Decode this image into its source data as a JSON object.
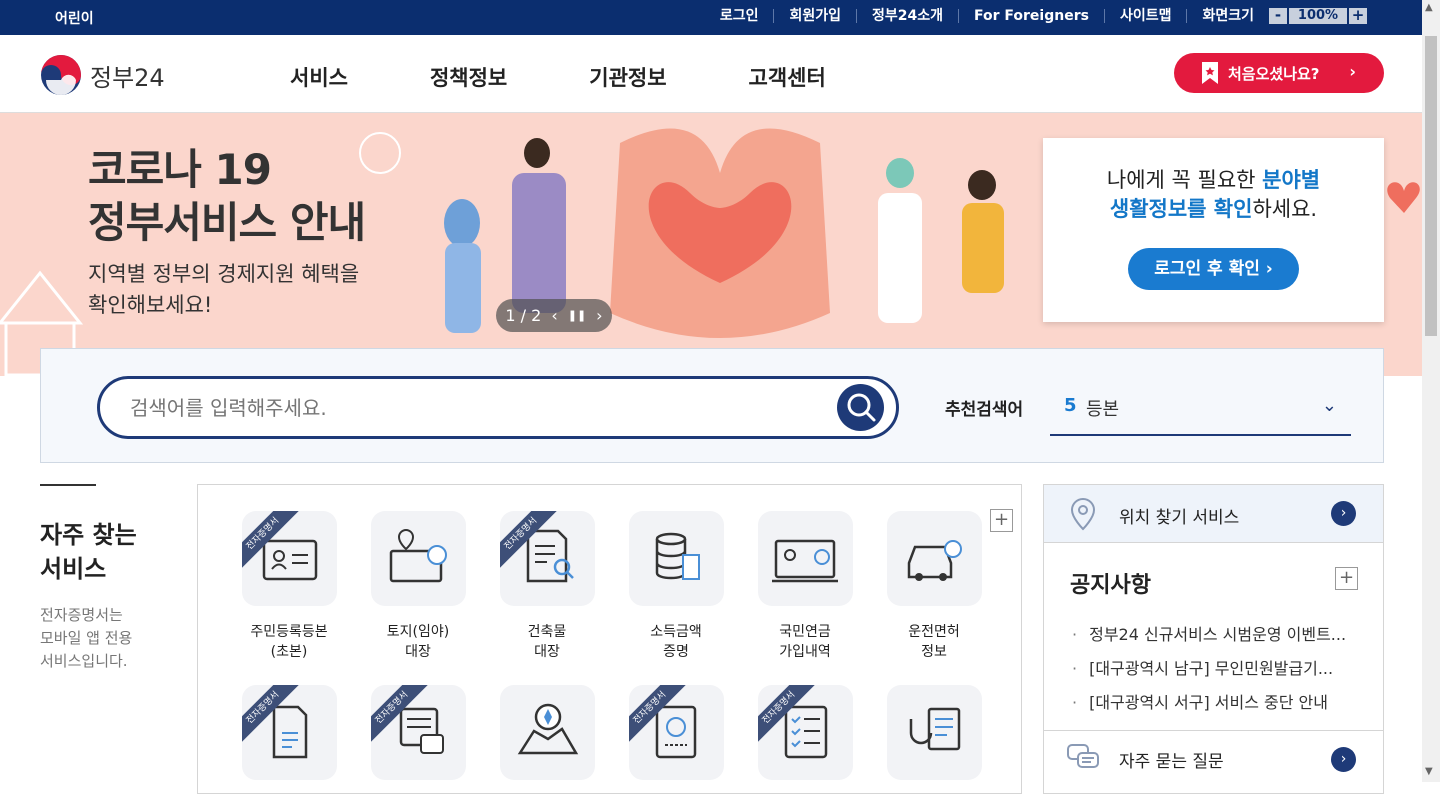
{
  "topbar": {
    "kids": "어린이",
    "links": [
      "로그인",
      "회원가입",
      "정부24소개",
      "For Foreigners",
      "사이트맵",
      "화면크기"
    ],
    "zoom_minus": "-",
    "zoom_value": "100%",
    "zoom_plus": "+"
  },
  "header": {
    "logo_text": "정부24",
    "nav": [
      "서비스",
      "정책정보",
      "기관정보",
      "고객센터"
    ],
    "first_visit": "처음오셨나요?"
  },
  "hero": {
    "title_line1": "코로나 19",
    "title_line2": "정부서비스 안내",
    "sub_line1": "지역별 정부의 경제지원 혜택을",
    "sub_line2": "확인해보세요!",
    "pager": "1 / 2",
    "info_line1_a": "나에게 꼭 필요한 ",
    "info_line1_b": "분야별",
    "info_line2_a": "생활정보를 확인",
    "info_line2_b": "하세요.",
    "info_button": "로그인 후 확인"
  },
  "search": {
    "placeholder": "검색어를 입력해주세요.",
    "rec_label": "추천검색어",
    "rec_num": "5",
    "rec_word": "등본"
  },
  "fav": {
    "title_line1": "자주 찾는",
    "title_line2": "서비스",
    "desc_line1": "전자증명서는",
    "desc_line2": "모바일 앱 전용",
    "desc_line3": "서비스입니다."
  },
  "services": [
    {
      "l1": "주민등록등본",
      "l2": "(초본)",
      "ribbon": "전자증명서",
      "icon": "id-card-icon"
    },
    {
      "l1": "토지(임야)",
      "l2": "대장",
      "ribbon": "",
      "icon": "map-monitor-icon"
    },
    {
      "l1": "건축물",
      "l2": "대장",
      "ribbon": "전자증명서",
      "icon": "document-search-icon"
    },
    {
      "l1": "소득금액",
      "l2": "증명",
      "ribbon": "",
      "icon": "coins-document-icon"
    },
    {
      "l1": "국민연금",
      "l2": "가입내역",
      "ribbon": "",
      "icon": "monitor-id-icon"
    },
    {
      "l1": "운전면허",
      "l2": "정보",
      "ribbon": "",
      "icon": "car-search-icon"
    },
    {
      "l1": "",
      "l2": "",
      "ribbon": "전자증명서",
      "icon": "document-icon"
    },
    {
      "l1": "",
      "l2": "",
      "ribbon": "전자증명서",
      "icon": "bus-scroll-icon"
    },
    {
      "l1": "",
      "l2": "",
      "ribbon": "",
      "icon": "map-compass-icon"
    },
    {
      "l1": "",
      "l2": "",
      "ribbon": "전자증명서",
      "icon": "passport-icon"
    },
    {
      "l1": "",
      "l2": "",
      "ribbon": "전자증명서",
      "icon": "checklist-icon"
    },
    {
      "l1": "",
      "l2": "",
      "ribbon": "",
      "icon": "stethoscope-icon"
    }
  ],
  "right": {
    "location": "위치 찾기 서비스",
    "notice_title": "공지사항",
    "notices": [
      "정부24 신규서비스 시범운영 이벤트...",
      "[대구광역시 남구] 무인민원발급기...",
      "[대구광역시 서구] 서비스 중단 안내"
    ],
    "faq": "자주 묻는 질문"
  },
  "colors": {
    "topbar": "#0b2e6f",
    "accent_red": "#e31a3e",
    "accent_blue": "#1a7bd0",
    "navy": "#1e3a78",
    "hero_bg": "#fbd6cc"
  }
}
